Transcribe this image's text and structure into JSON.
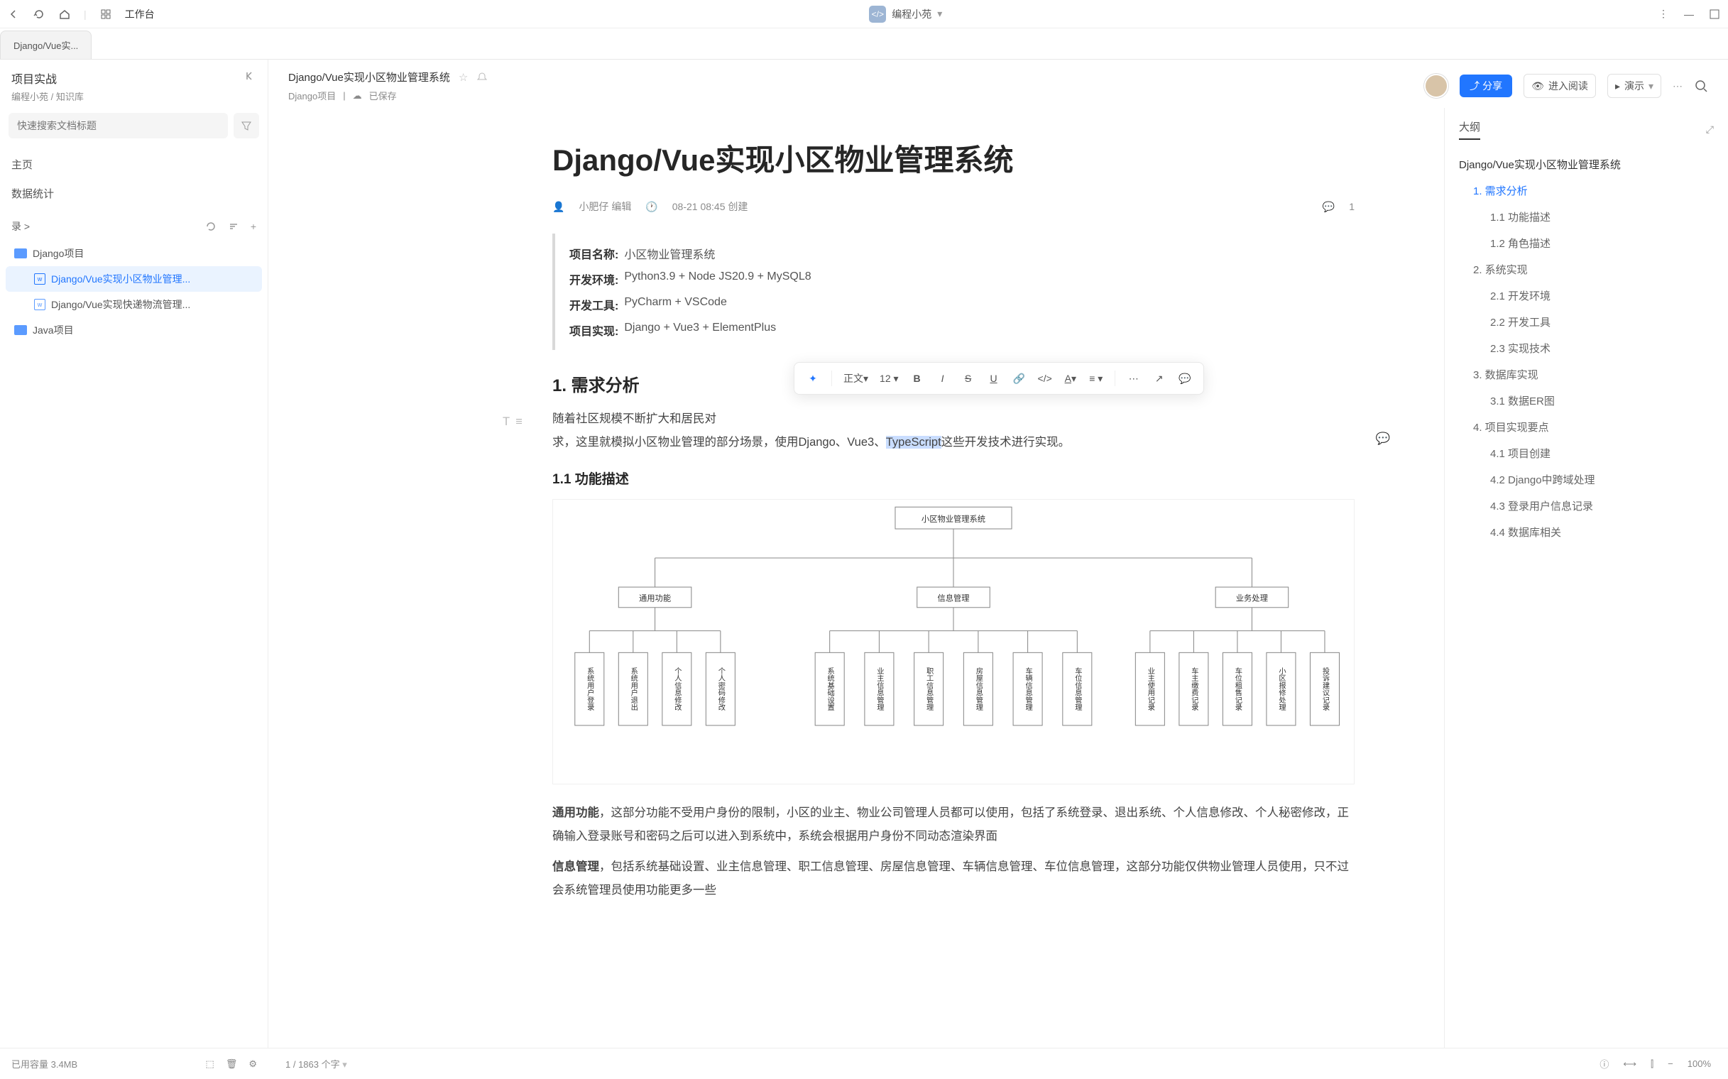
{
  "titlebar": {
    "workspace": "工作台",
    "app_name": "编程小苑"
  },
  "tab": {
    "label": "Django/Vue实..."
  },
  "sidebar": {
    "title": "项目实战",
    "breadcrumb": "编程小苑 / 知识库",
    "search_placeholder": "快速搜索文档标题",
    "nav_home": "主页",
    "nav_stats": "数据统计",
    "section": "录 >",
    "tree": {
      "folder1": "Django项目",
      "doc1": "Django/Vue实现小区物业管理...",
      "doc2": "Django/Vue实现快递物流管理...",
      "folder2": "Java项目"
    },
    "footer": "已用容量 3.4MB"
  },
  "doc_header": {
    "title": "Django/Vue实现小区物业管理系统",
    "project": "Django项目",
    "saved": "已保存",
    "share": "分享",
    "reading": "进入阅读",
    "present": "演示"
  },
  "doc": {
    "h1": "Django/Vue实现小区物业管理系统",
    "author": "小肥仔 编辑",
    "created": "08-21 08:45 创建",
    "comments": "1",
    "info": {
      "l1": "项目名称:",
      "v1": "小区物业管理系统",
      "l2": "开发环境:",
      "v2": "Python3.9 + Node JS20.9 + MySQL8",
      "l3": "开发工具:",
      "v3": "PyCharm + VSCode",
      "l4": "项目实现:",
      "v4": "Django + Vue3 + ElementPlus"
    },
    "h2_1": "1. 需求分析",
    "p1a": "随着社区规模不断扩大和居民对",
    "p1b": "求，这里就模拟小区物业管理的部分场景，使用Django、Vue3、",
    "p1_highlight": "TypeScript",
    "p1c": "这些开发技术进行实现。",
    "h3_1": "1.1 功能描述",
    "p2a": "通用功能",
    "p2b": "，这部分功能不受用户身份的限制，小区的业主、物业公司管理人员都可以使用，包括了系统登录、退出系统、个人信息修改、个人秘密修改，正确输入登录账号和密码之后可以进入到系统中，系统会根据用户身份不同动态渲染界面",
    "p3a": "信息管理",
    "p3b": "，包括系统基础设置、业主信息管理、职工信息管理、房屋信息管理、车辆信息管理、车位信息管理，这部分功能仅供物业管理人员使用，只不过会系统管理员使用功能更多一些",
    "toolbar": {
      "style": "正文",
      "size": "12"
    },
    "diagram": {
      "root": "小区物业管理系统",
      "g1": "通用功能",
      "g2": "信息管理",
      "g3": "业务处理",
      "leaves": [
        "系统用户登录",
        "系统用户退出",
        "个人信息修改",
        "个人密码修改",
        "系统基础设置",
        "业主信息管理",
        "职工信息管理",
        "房屋信息管理",
        "车辆信息管理",
        "车位信息管理",
        "业主使用记录",
        "车主缴费记录",
        "车位租售记录",
        "小区报修处理",
        "投诉建议记录"
      ]
    }
  },
  "outline": {
    "title": "大纲",
    "items": [
      {
        "lvl": 1,
        "text": "Django/Vue实现小区物业管理系统"
      },
      {
        "lvl": 2,
        "text": "1. 需求分析",
        "active": true
      },
      {
        "lvl": 3,
        "text": "1.1 功能描述"
      },
      {
        "lvl": 3,
        "text": "1.2 角色描述"
      },
      {
        "lvl": 2,
        "text": "2. 系统实现"
      },
      {
        "lvl": 3,
        "text": "2.1 开发环境"
      },
      {
        "lvl": 3,
        "text": "2.2 开发工具"
      },
      {
        "lvl": 3,
        "text": "2.3 实现技术"
      },
      {
        "lvl": 2,
        "text": "3. 数据库实现"
      },
      {
        "lvl": 3,
        "text": "3.1 数据ER图"
      },
      {
        "lvl": 2,
        "text": "4. 项目实现要点"
      },
      {
        "lvl": 3,
        "text": "4.1 项目创建"
      },
      {
        "lvl": 3,
        "text": "4.2 Django中跨域处理"
      },
      {
        "lvl": 3,
        "text": "4.3 登录用户信息记录"
      },
      {
        "lvl": 3,
        "text": "4.4 数据库相关"
      }
    ]
  },
  "footer": {
    "count": "1 / 1863 个字",
    "zoom": "100%"
  }
}
